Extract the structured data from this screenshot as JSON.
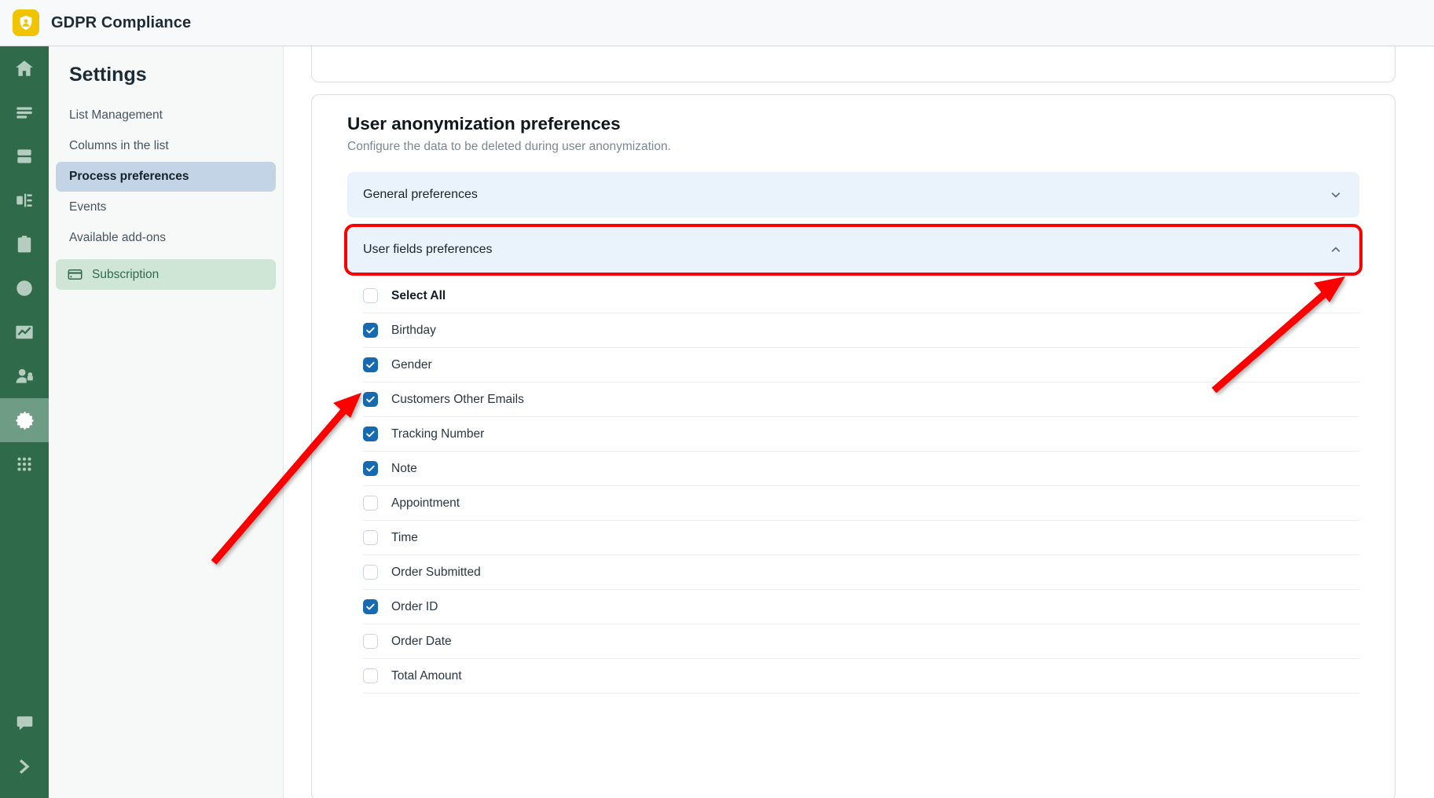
{
  "header": {
    "title": "GDPR Compliance",
    "logo_icon": "shield-person-icon"
  },
  "rail": {
    "items": [
      {
        "name": "home",
        "icon": "home-icon",
        "active": false
      },
      {
        "name": "lists",
        "icon": "menu-lines-icon",
        "active": false
      },
      {
        "name": "database",
        "icon": "database-icon",
        "active": false
      },
      {
        "name": "flows",
        "icon": "flow-chart-icon",
        "active": false
      },
      {
        "name": "clipboard",
        "icon": "clipboard-user-icon",
        "active": false
      },
      {
        "name": "history",
        "icon": "clock-icon",
        "active": false
      },
      {
        "name": "reports",
        "icon": "chart-line-icon",
        "active": false
      },
      {
        "name": "privacy",
        "icon": "user-lock-icon",
        "active": false
      },
      {
        "name": "settings",
        "icon": "gear-icon",
        "active": true
      },
      {
        "name": "apps",
        "icon": "grid-dots-icon",
        "active": false
      }
    ],
    "bottom_items": [
      {
        "name": "feedback",
        "icon": "chat-icon",
        "active": false
      },
      {
        "name": "expand",
        "icon": "chevron-right-icon",
        "active": false
      }
    ]
  },
  "settings": {
    "title": "Settings",
    "nav": [
      {
        "label": "List Management",
        "selected": false,
        "icon": null
      },
      {
        "label": "Columns in the list",
        "selected": false,
        "icon": null
      },
      {
        "label": "Process preferences",
        "selected": true,
        "icon": null
      },
      {
        "label": "Events",
        "selected": false,
        "icon": null
      },
      {
        "label": "Available add-ons",
        "selected": false,
        "icon": null
      }
    ],
    "subscription": {
      "label": "Subscription",
      "icon": "credit-card-icon"
    }
  },
  "main": {
    "section_title": "User anonymization preferences",
    "section_subtitle": "Configure the data to be deleted during user anonymization.",
    "accordions": [
      {
        "label": "General preferences",
        "expanded": false,
        "icon": "chevron-down-icon"
      },
      {
        "label": "User fields preferences",
        "expanded": true,
        "icon": "chevron-up-icon"
      }
    ],
    "fields": [
      {
        "label": "Select All",
        "checked": false,
        "bold": true
      },
      {
        "label": "Birthday",
        "checked": true,
        "bold": false
      },
      {
        "label": "Gender",
        "checked": true,
        "bold": false
      },
      {
        "label": "Customers Other Emails",
        "checked": true,
        "bold": false
      },
      {
        "label": "Tracking Number",
        "checked": true,
        "bold": false
      },
      {
        "label": "Note",
        "checked": true,
        "bold": false
      },
      {
        "label": "Appointment",
        "checked": false,
        "bold": false
      },
      {
        "label": "Time",
        "checked": false,
        "bold": false
      },
      {
        "label": "Order Submitted",
        "checked": false,
        "bold": false
      },
      {
        "label": "Order ID",
        "checked": true,
        "bold": false
      },
      {
        "label": "Order Date",
        "checked": false,
        "bold": false
      },
      {
        "label": "Total Amount",
        "checked": false,
        "bold": false
      }
    ]
  },
  "colors": {
    "brand_yellow": "#f0c400",
    "rail_green": "#2f6b4a",
    "accent_blue": "#1769b0",
    "accordion_blue": "#eaf3fc",
    "annotation_red": "#fc0000",
    "selected_nav": "#c2d4e5",
    "subscription_green": "#cfe5d6"
  }
}
